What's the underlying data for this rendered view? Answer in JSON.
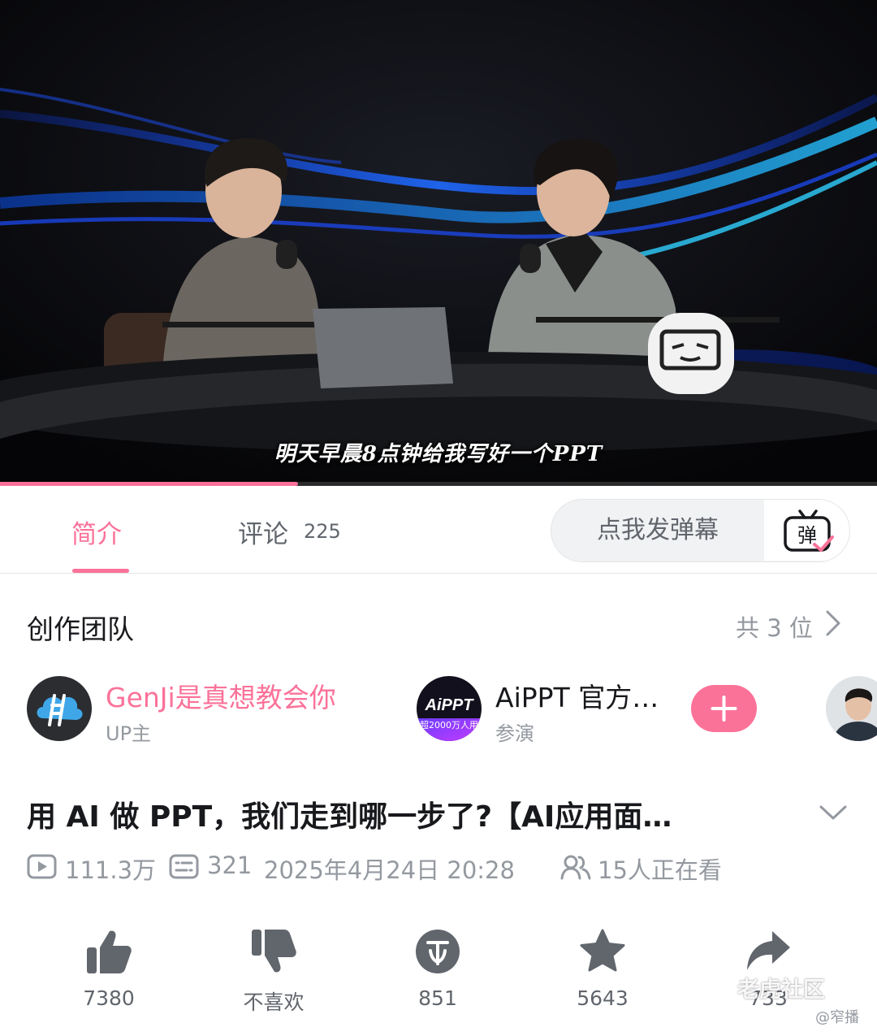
{
  "video": {
    "subtitle": "明天早晨8点钟给我写好一个PPT",
    "progress_fraction": 0.34
  },
  "tabs": {
    "intro_label": "简介",
    "comments_label": "评论",
    "comments_count": "225",
    "danmaku_placeholder": "点我发弹幕",
    "danmaku_icon_text": "弹"
  },
  "creators": {
    "title": "创作团队",
    "count_label": "共 3 位",
    "items": [
      {
        "name": "GenJi是真想教会你",
        "role": "UP主"
      },
      {
        "name": "AiPPT 官方…",
        "role": "参演",
        "logo_text": "AiPPT",
        "logo_sub": "超2000万人用"
      }
    ]
  },
  "video_info": {
    "title": "用 AI 做 PPT，我们走到哪一步了?【AI应用面…",
    "views": "111.3万",
    "danmaku_count": "321",
    "publish_time": "2025年4月24日 20:28",
    "watching": "15人正在看"
  },
  "actions": {
    "like_count": "7380",
    "dislike_label": "不喜欢",
    "coin_count": "851",
    "favorite_count": "5643",
    "share_count": "733"
  },
  "watermark": {
    "text": "老虎社区",
    "sub": "@窄播"
  },
  "colors": {
    "accent": "#fb7299",
    "icon_gray": "#61666d",
    "text_gray": "#9499a0"
  }
}
